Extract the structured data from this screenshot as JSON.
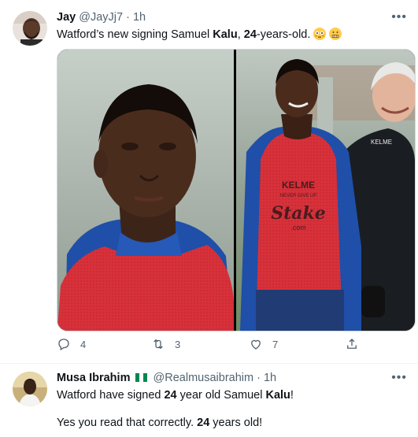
{
  "tweet1": {
    "name": "Jay",
    "handle": "@JayJj7",
    "dot": "·",
    "time": "1h",
    "text": {
      "part1": "Watford’s new signing Samuel ",
      "bold1": "Kalu",
      "part2": ", ",
      "bold2": "24",
      "part3": "-years-old. "
    },
    "emojis": [
      "flushed-face-emoji",
      "grimacing-face-emoji"
    ],
    "media": {
      "vest_brand": "KELME",
      "vest_sub": "NEVER GIVE UP",
      "sponsor": "Stake",
      "sponsor_sub": ".com",
      "jacket_brand": "KELME"
    },
    "actions": {
      "reply_count": "4",
      "retweet_count": "3",
      "like_count": "7"
    }
  },
  "tweet2": {
    "name": "Musa Ibrahim",
    "handle": "@Realmusaibrahim",
    "dot": "·",
    "time": "1h",
    "flag": "nigeria-flag-emoji",
    "line1": {
      "part1": "Watford have signed ",
      "bold1": "24",
      "part2": " year old Samuel ",
      "bold2": "Kalu",
      "part3": "!"
    },
    "line2": {
      "part1": "Yes you read that correctly. ",
      "bold1": "24",
      "part2": " years old!"
    }
  },
  "colors": {
    "text": "#0f1419",
    "muted": "#536471",
    "divider": "#eff3f4",
    "vest_red": "#d8313a",
    "jacket_blue": "#1f4fa8"
  }
}
